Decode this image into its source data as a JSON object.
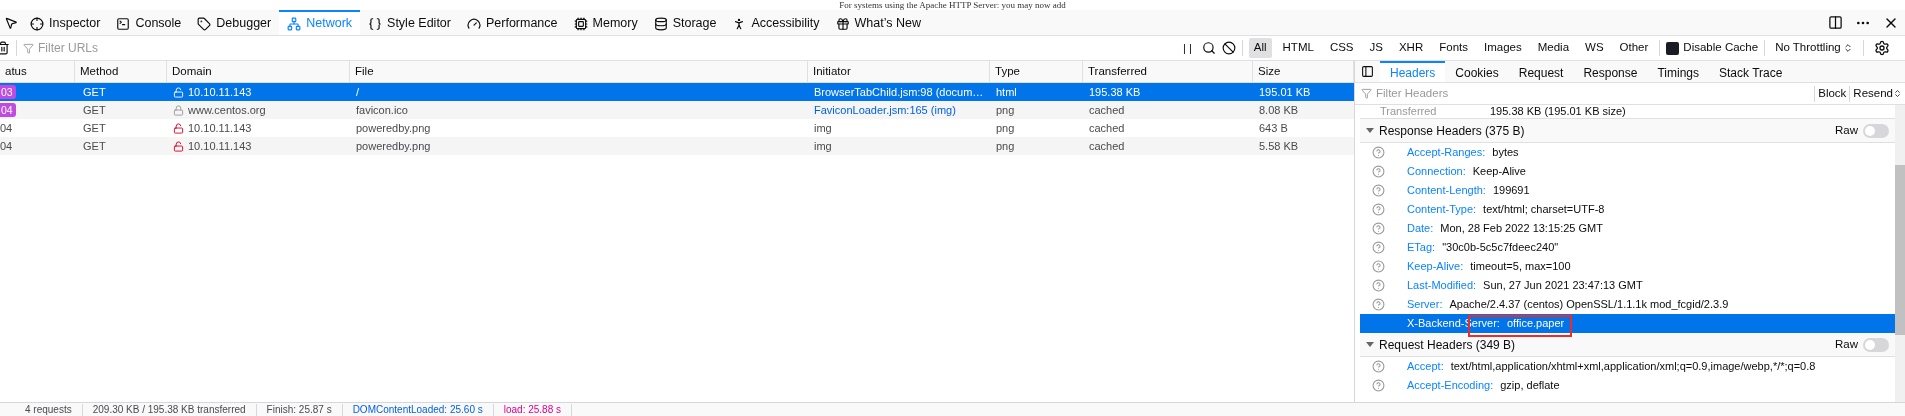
{
  "page_text": "For systems using the Apache HTTP Server: you may now add",
  "tools": [
    {
      "label": "Inspector",
      "selected": false
    },
    {
      "label": "Console",
      "selected": false
    },
    {
      "label": "Debugger",
      "selected": false
    },
    {
      "label": "Network",
      "selected": true
    },
    {
      "label": "Style Editor",
      "selected": false
    },
    {
      "label": "Performance",
      "selected": false
    },
    {
      "label": "Memory",
      "selected": false
    },
    {
      "label": "Storage",
      "selected": false
    },
    {
      "label": "Accessibility",
      "selected": false
    },
    {
      "label": "What’s New",
      "selected": false
    }
  ],
  "filter": {
    "placeholder": "Filter URLs",
    "pause": "| |"
  },
  "type_filters": [
    {
      "label": "All",
      "selected": true
    },
    {
      "label": "HTML",
      "selected": false
    },
    {
      "label": "CSS",
      "selected": false
    },
    {
      "label": "JS",
      "selected": false
    },
    {
      "label": "XHR",
      "selected": false
    },
    {
      "label": "Fonts",
      "selected": false
    },
    {
      "label": "Images",
      "selected": false
    },
    {
      "label": "Media",
      "selected": false
    },
    {
      "label": "WS",
      "selected": false
    },
    {
      "label": "Other",
      "selected": false
    }
  ],
  "disable_cache": {
    "label": "Disable Cache",
    "checked": true
  },
  "throttling": "No Throttling",
  "table": {
    "columns": [
      "atus",
      "Method",
      "Domain",
      "File",
      "Initiator",
      "Type",
      "Transferred",
      "Size"
    ],
    "rows": [
      {
        "selected": true,
        "status": "03",
        "badge": true,
        "method": "GET",
        "secure": false,
        "domain": "10.10.11.143",
        "file": "/",
        "initiator": "BrowserTabChild.jsm:98 (docum…",
        "initiator_link": false,
        "type": "html",
        "transferred": "195.38 KB",
        "size": "195.01 KB"
      },
      {
        "selected": false,
        "status": "04",
        "badge": true,
        "method": "GET",
        "secure": true,
        "domain": "www.centos.org",
        "file": "favicon.ico",
        "initiator": "FaviconLoader.jsm:165 (img)",
        "initiator_link": true,
        "type": "png",
        "transferred": "cached",
        "size": "8.08 KB"
      },
      {
        "selected": false,
        "status": "04",
        "badge": false,
        "method": "GET",
        "secure": false,
        "domain": "10.10.11.143",
        "file": "poweredby.png",
        "initiator": "img",
        "initiator_link": false,
        "type": "png",
        "transferred": "cached",
        "size": "643 B"
      },
      {
        "selected": false,
        "status": "04",
        "badge": false,
        "method": "GET",
        "secure": false,
        "domain": "10.10.11.143",
        "file": "poweredby.png",
        "initiator": "img",
        "initiator_link": false,
        "type": "png",
        "transferred": "cached",
        "size": "5.58 KB"
      }
    ]
  },
  "status_bar": [
    "4 requests",
    "209.30 KB / 195.38 KB transferred",
    "Finish: 25.87 s",
    "DOMContentLoaded: 25.60 s",
    "load: 25.88 s"
  ],
  "details": {
    "tabs": [
      {
        "label": "Headers",
        "selected": true
      },
      {
        "label": "Cookies",
        "selected": false
      },
      {
        "label": "Request",
        "selected": false
      },
      {
        "label": "Response",
        "selected": false
      },
      {
        "label": "Timings",
        "selected": false
      },
      {
        "label": "Stack Trace",
        "selected": false
      }
    ],
    "filter_placeholder": "Filter Headers",
    "block": "Block",
    "resend": "Resend",
    "summary": {
      "name": "Transferred",
      "value": "195.38 KB (195.01 KB size)"
    },
    "sections": [
      {
        "title": "Response Headers (375 B)",
        "raw": "Raw",
        "raw_on": false,
        "expanded": true,
        "headers": [
          {
            "name": "Accept-Ranges:",
            "value": "bytes",
            "selected": false
          },
          {
            "name": "Connection:",
            "value": "Keep-Alive",
            "selected": false
          },
          {
            "name": "Content-Length:",
            "value": "199691",
            "selected": false
          },
          {
            "name": "Content-Type:",
            "value": "text/html; charset=UTF-8",
            "selected": false
          },
          {
            "name": "Date:",
            "value": "Mon, 28 Feb 2022 13:15:25 GMT",
            "selected": false
          },
          {
            "name": "ETag:",
            "value": "\"30c0b-5c5c7fdeec240\"",
            "selected": false
          },
          {
            "name": "Keep-Alive:",
            "value": "timeout=5, max=100",
            "selected": false
          },
          {
            "name": "Last-Modified:",
            "value": "Sun, 27 Jun 2021 23:47:13 GMT",
            "selected": false
          },
          {
            "name": "Server:",
            "value": "Apache/2.4.37 (centos) OpenSSL/1.1.1k mod_fcgid/2.3.9",
            "selected": false
          },
          {
            "name": "X-Backend-Server:",
            "value": "office.paper",
            "selected": true,
            "annotated": true
          }
        ]
      },
      {
        "title": "Request Headers (349 B)",
        "raw": "Raw",
        "raw_on": false,
        "expanded": true,
        "headers": [
          {
            "name": "Accept:",
            "value": "text/html,application/xhtml+xml,application/xml;q=0.9,image/webp,*/*;q=0.8",
            "selected": false
          },
          {
            "name": "Accept-Encoding:",
            "value": "gzip, deflate",
            "selected": false
          }
        ]
      }
    ]
  }
}
